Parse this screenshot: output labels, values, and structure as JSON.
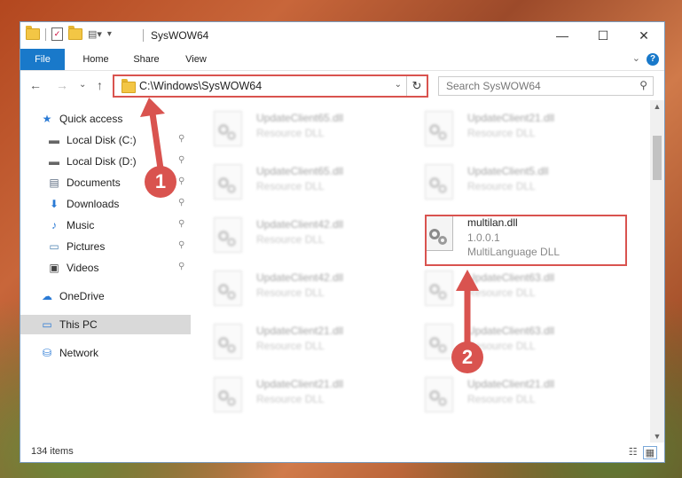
{
  "window": {
    "title": "SysWOW64",
    "controls": {
      "minimize": "—",
      "maximize": "☐",
      "close": "✕"
    }
  },
  "ribbon": {
    "tabs": [
      "File",
      "Home",
      "Share",
      "View"
    ],
    "help": "?",
    "expand": "⌄"
  },
  "navigation": {
    "back": "←",
    "forward": "→",
    "recent": "⌄",
    "up": "↑",
    "address": "C:\\Windows\\SysWOW64",
    "dropdown": "⌄",
    "refresh": "↻",
    "search_placeholder": "Search SysWOW64"
  },
  "sidebar": {
    "items": [
      {
        "label": "Quick access",
        "icon": "star-icon",
        "glyph": "★",
        "pinned": false
      },
      {
        "label": "Local Disk (C:)",
        "icon": "drive-icon",
        "glyph": "▬",
        "pinned": true
      },
      {
        "label": "Local Disk (D:)",
        "icon": "drive-icon",
        "glyph": "▬",
        "pinned": true
      },
      {
        "label": "Documents",
        "icon": "documents-icon",
        "glyph": "▤",
        "pinned": true
      },
      {
        "label": "Downloads",
        "icon": "download-icon",
        "glyph": "⬇",
        "pinned": true
      },
      {
        "label": "Music",
        "icon": "music-icon",
        "glyph": "♪",
        "pinned": true
      },
      {
        "label": "Pictures",
        "icon": "pictures-icon",
        "glyph": "▭",
        "pinned": true
      },
      {
        "label": "Videos",
        "icon": "videos-icon",
        "glyph": "▣",
        "pinned": true
      },
      {
        "label": "OneDrive",
        "icon": "cloud-icon",
        "glyph": "☁",
        "pinned": false
      },
      {
        "label": "This PC",
        "icon": "computer-icon",
        "glyph": "▭",
        "pinned": false
      },
      {
        "label": "Network",
        "icon": "network-icon",
        "glyph": "⛁",
        "pinned": false
      }
    ],
    "pin_glyph": "⚲"
  },
  "files": [
    {
      "name": "UpdateClient65.dll",
      "desc": "Resource DLL"
    },
    {
      "name": "UpdateClient21.dll",
      "desc": "Resource DLL"
    },
    {
      "name": "UpdateClient65.dll",
      "desc": "Resource DLL"
    },
    {
      "name": "UpdateClient5.dll",
      "desc": "Resource DLL"
    },
    {
      "name": "UpdateClient42.dll",
      "desc": "Resource DLL"
    },
    {
      "name": "multilan.dll",
      "version": "1.0.0.1",
      "desc": "MultiLanguage DLL"
    },
    {
      "name": "UpdateClient42.dll",
      "desc": "Resource DLL"
    },
    {
      "name": "UpdateClient63.dll",
      "desc": "Resource DLL"
    },
    {
      "name": "UpdateClient21.dll",
      "desc": "Resource DLL"
    },
    {
      "name": "UpdateClient63.dll",
      "desc": "Resource DLL"
    },
    {
      "name": "UpdateClient21.dll",
      "desc": "Resource DLL"
    },
    {
      "name": "UpdateClient21.dll",
      "desc": "Resource DLL"
    }
  ],
  "status": {
    "item_count": "134 items"
  },
  "annotations": {
    "step1": "1",
    "step2": "2",
    "color": "#d9534f"
  }
}
